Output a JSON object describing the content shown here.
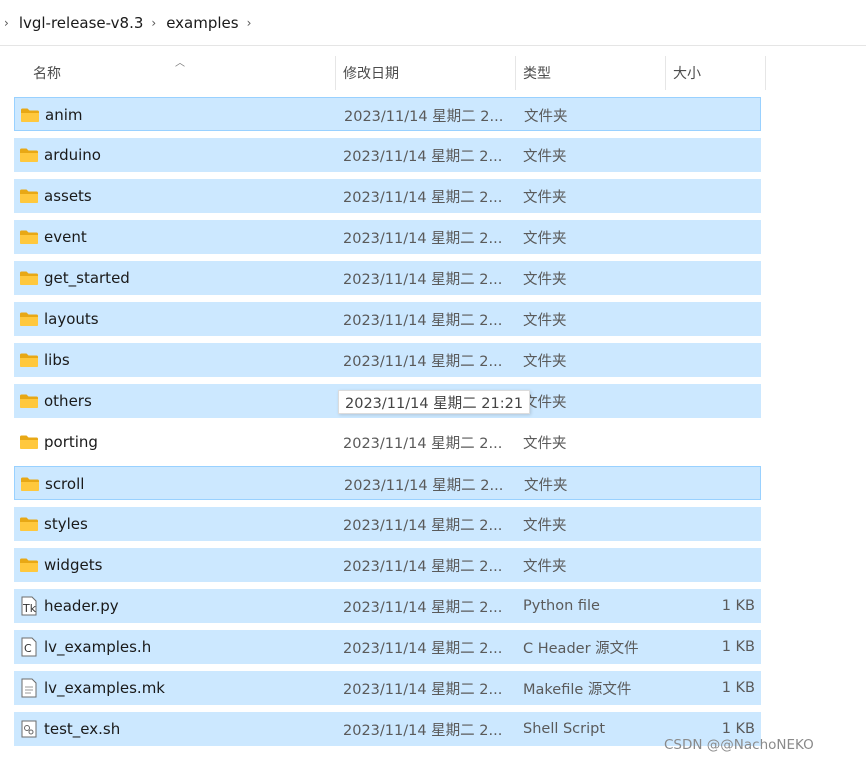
{
  "breadcrumb": {
    "segments": [
      "lvgl-release-v8.3",
      "examples"
    ]
  },
  "columns": {
    "name": "名称",
    "date": "修改日期",
    "type": "类型",
    "size": "大小"
  },
  "files": [
    {
      "name": "anim",
      "date": "2023/11/14 星期二 2...",
      "type": "文件夹",
      "size": "",
      "icon": "folder-icon",
      "state": "selected-focused"
    },
    {
      "name": "arduino",
      "date": "2023/11/14 星期二 2...",
      "type": "文件夹",
      "size": "",
      "icon": "folder-icon",
      "state": "selected"
    },
    {
      "name": "assets",
      "date": "2023/11/14 星期二 2...",
      "type": "文件夹",
      "size": "",
      "icon": "folder-icon",
      "state": "selected"
    },
    {
      "name": "event",
      "date": "2023/11/14 星期二 2...",
      "type": "文件夹",
      "size": "",
      "icon": "folder-icon",
      "state": "selected"
    },
    {
      "name": "get_started",
      "date": "2023/11/14 星期二 2...",
      "type": "文件夹",
      "size": "",
      "icon": "folder-icon",
      "state": "selected"
    },
    {
      "name": "layouts",
      "date": "2023/11/14 星期二 2...",
      "type": "文件夹",
      "size": "",
      "icon": "folder-icon",
      "state": "selected"
    },
    {
      "name": "libs",
      "date": "2023/11/14 星期二 2...",
      "type": "文件夹",
      "size": "",
      "icon": "folder-icon",
      "state": "selected"
    },
    {
      "name": "others",
      "date": "",
      "type": "文件夹",
      "size": "",
      "icon": "folder-icon",
      "state": "selected"
    },
    {
      "name": "porting",
      "date": "2023/11/14 星期二 2...",
      "type": "文件夹",
      "size": "",
      "icon": "folder-icon",
      "state": "plain"
    },
    {
      "name": "scroll",
      "date": "2023/11/14 星期二 2...",
      "type": "文件夹",
      "size": "",
      "icon": "folder-icon",
      "state": "selected-focused"
    },
    {
      "name": "styles",
      "date": "2023/11/14 星期二 2...",
      "type": "文件夹",
      "size": "",
      "icon": "folder-icon",
      "state": "selected"
    },
    {
      "name": "widgets",
      "date": "2023/11/14 星期二 2...",
      "type": "文件夹",
      "size": "",
      "icon": "folder-icon",
      "state": "selected"
    },
    {
      "name": "header.py",
      "date": "2023/11/14 星期二 2...",
      "type": "Python file",
      "size": "1 KB",
      "icon": "python-file-icon",
      "state": "selected"
    },
    {
      "name": "lv_examples.h",
      "date": "2023/11/14 星期二 2...",
      "type": "C Header 源文件",
      "size": "1 KB",
      "icon": "c-header-file-icon",
      "state": "selected"
    },
    {
      "name": "lv_examples.mk",
      "date": "2023/11/14 星期二 2...",
      "type": "Makefile 源文件",
      "size": "1 KB",
      "icon": "text-file-icon",
      "state": "selected"
    },
    {
      "name": "test_ex.sh",
      "date": "2023/11/14 星期二 2...",
      "type": "Shell Script",
      "size": "1 KB",
      "icon": "script-file-icon",
      "state": "selected"
    }
  ],
  "tooltip": {
    "text": "2023/11/14 星期二 21:21"
  },
  "watermark": "CSDN @@NachoNEKO",
  "colors": {
    "selection": "#cce8ff",
    "focus_border": "#99d1ff",
    "folder": "#ffc83d"
  }
}
